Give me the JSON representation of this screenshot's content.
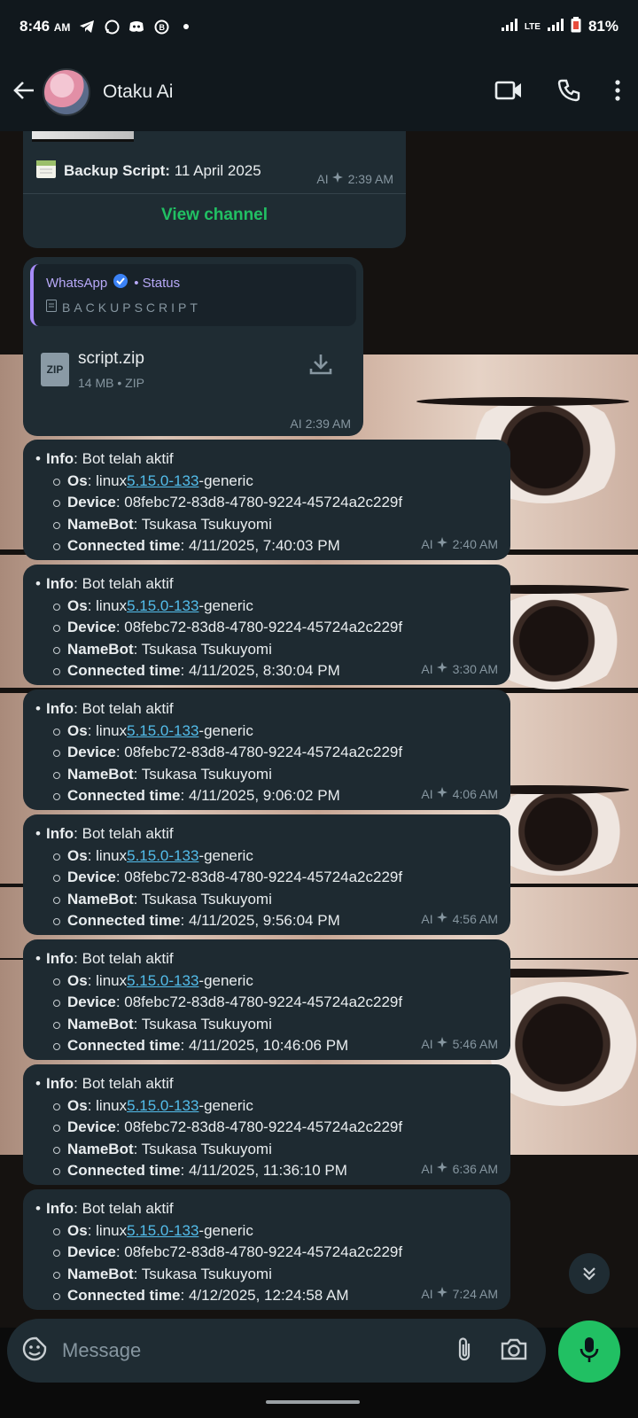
{
  "status_bar": {
    "time": "8:46",
    "ampm": "AM",
    "notification_icons": [
      "telegram-icon",
      "whatsapp-icon",
      "discord-icon",
      "whatsapp-business-icon",
      "dot-icon"
    ],
    "network": "LTE",
    "battery": "81%"
  },
  "header": {
    "back_icon": "back-arrow-icon",
    "chat_name": "Otaku Ai",
    "actions": [
      "video-call-icon",
      "voice-call-icon",
      "more-options-icon"
    ]
  },
  "channel_post": {
    "emoji": "calendar-icon",
    "label_bold": "Backup Script:",
    "label_rest": " 11 April 2025",
    "sender_tag": "AI",
    "time": "2:39 AM",
    "button": "View channel"
  },
  "document_message": {
    "quote_source": "WhatsApp",
    "quote_suffix": "• Status",
    "quote_text": "BACKUPSCRIPT",
    "file_icon": "ZIP",
    "file_name": "script.zip",
    "file_meta": "14 MB • ZIP",
    "sender_tag": "AI",
    "time": "2:39 AM"
  },
  "info_label": "Info",
  "info_text": ": Bot telah aktif",
  "os_label": "Os",
  "os_prefix": ": linux ",
  "os_link": "5.15.0-133",
  "os_suffix": "-generic",
  "device_label": "Device",
  "device_value": ": 08febc72-83d8-4780-9224-45724a2c229f",
  "namebot_label": "NameBot",
  "namebot_value": ": Tsukasa Tsukuyomi",
  "connected_label": "Connected time",
  "sender_tag": "AI",
  "bot_messages": [
    {
      "connected": ": 4/11/2025, 7:40:03 PM",
      "time": "2:40 AM"
    },
    {
      "connected": ": 4/11/2025, 8:30:04 PM",
      "time": "3:30 AM"
    },
    {
      "connected": ": 4/11/2025, 9:06:02 PM",
      "time": "4:06 AM"
    },
    {
      "connected": ": 4/11/2025, 9:56:04 PM",
      "time": "4:56 AM"
    },
    {
      "connected": ": 4/11/2025, 10:46:06 PM",
      "time": "5:46 AM"
    },
    {
      "connected": ": 4/11/2025, 11:36:10 PM",
      "time": "6:36 AM"
    },
    {
      "connected": ": 4/12/2025, 12:24:58 AM",
      "time": "7:24 AM"
    }
  ],
  "composer": {
    "placeholder": "Message",
    "icons": [
      "sticker-icon",
      "attach-icon",
      "camera-icon",
      "mic-icon"
    ]
  },
  "colors": {
    "bubble": "#1f2c33",
    "accent_green": "#21c063",
    "link": "#53bdeb",
    "app_bar": "#11181d"
  }
}
